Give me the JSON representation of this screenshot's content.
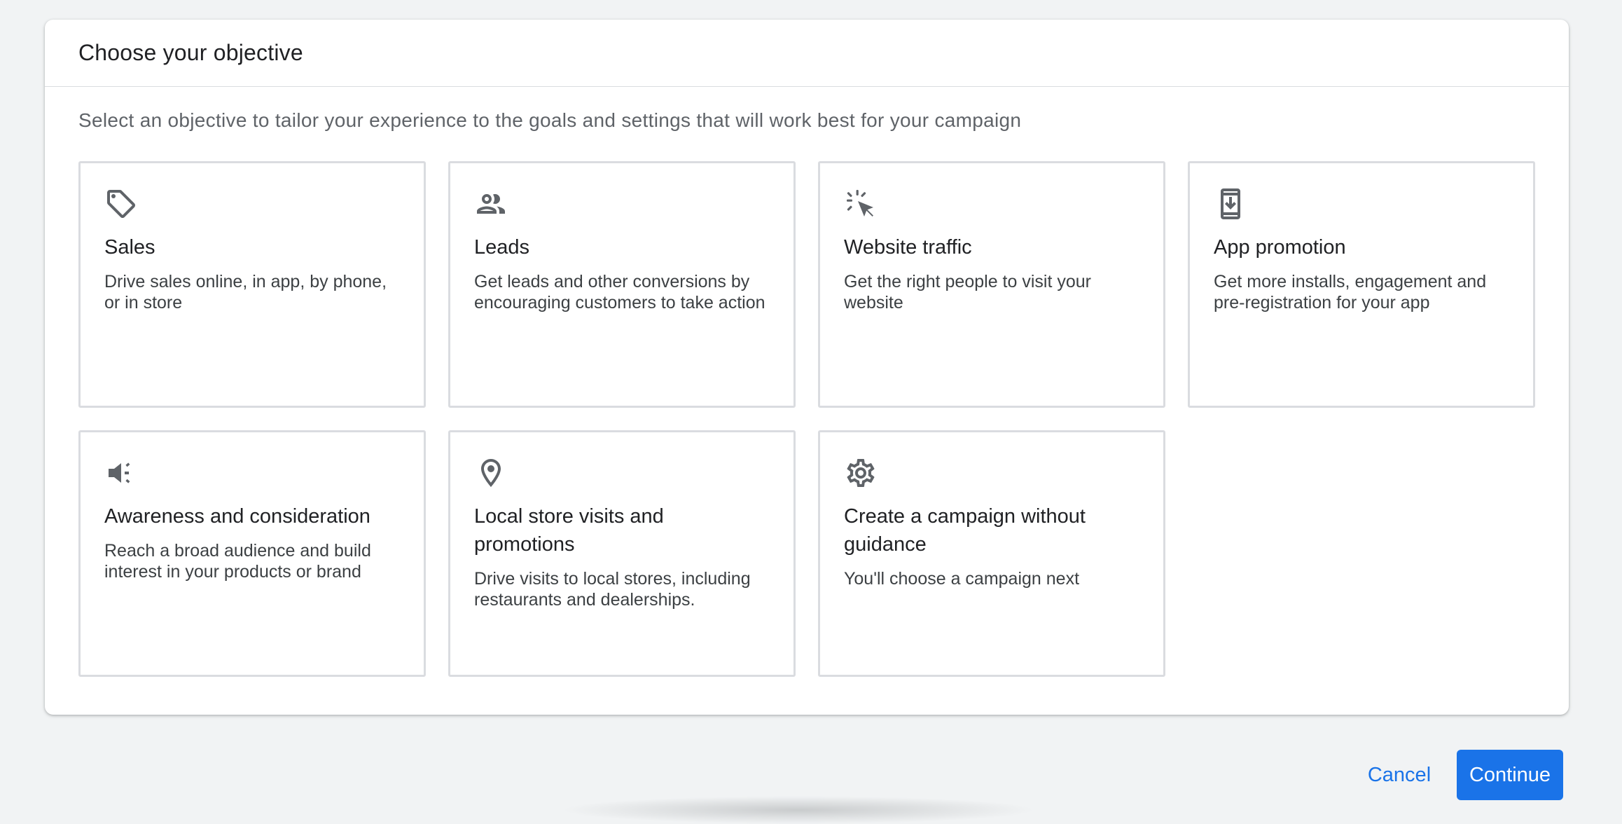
{
  "dialog": {
    "title": "Choose your objective",
    "subtitle": "Select an objective to tailor your experience to the goals and settings that will work best for your campaign"
  },
  "objectives": [
    {
      "icon": "tag-icon",
      "title": "Sales",
      "description": "Drive sales online, in app, by phone, or in store"
    },
    {
      "icon": "people-icon",
      "title": "Leads",
      "description": "Get leads and other conversions by encouraging customers to take action"
    },
    {
      "icon": "cursor-click-icon",
      "title": "Website traffic",
      "description": "Get the right people to visit your website"
    },
    {
      "icon": "phone-download-icon",
      "title": "App promotion",
      "description": "Get more installs, engagement and pre-registration for your app"
    },
    {
      "icon": "megaphone-icon",
      "title": "Awareness and consideration",
      "description": "Reach a broad audience and build interest in your products or brand"
    },
    {
      "icon": "location-pin-icon",
      "title": "Local store visits and promotions",
      "description": "Drive visits to local stores, including restaurants and dealerships."
    },
    {
      "icon": "gear-icon",
      "title": "Create a campaign without guidance",
      "description": "You'll choose a campaign next"
    }
  ],
  "footer": {
    "cancel_label": "Cancel",
    "continue_label": "Continue"
  },
  "colors": {
    "accent": "#1a73e8",
    "icon": "#5f6368",
    "card_border": "#dadce0"
  }
}
